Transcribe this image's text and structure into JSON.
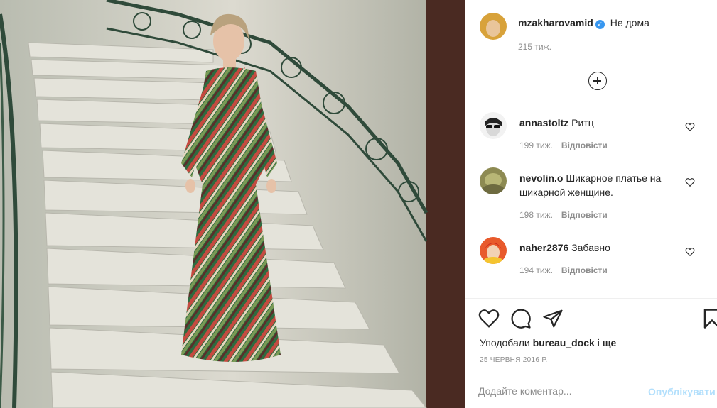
{
  "post": {
    "author": "mzakharovamid",
    "caption": "Не дома",
    "time": "215 тиж.",
    "verified_icon": "verified-badge-icon"
  },
  "comments": [
    {
      "user": "annastoltz",
      "text": "Ритц",
      "time": "199 тиж.",
      "reply": "Відповісти"
    },
    {
      "user": "nevolin.o",
      "text": "Шикарное платье на шикарной женщине.",
      "time": "198 тиж.",
      "reply": "Відповісти"
    },
    {
      "user": "naher2876",
      "text": "Забавно",
      "time": "194 тиж.",
      "reply": "Відповісти"
    }
  ],
  "likes": {
    "prefix": "Уподобали",
    "user": "bureau_dock",
    "and": "і",
    "more": "ще"
  },
  "date": "25 ЧЕРВНЯ 2016 Р.",
  "add_comment": {
    "placeholder": "Додайте коментар...",
    "post_label": "Опублікувати"
  },
  "icons": {
    "like": "heart-icon",
    "comment": "comment-bubble-icon",
    "share": "paper-plane-icon",
    "save": "bookmark-icon",
    "load_more": "plus-circle-icon"
  },
  "colors": {
    "text": "#262626",
    "muted": "#8e8e8e",
    "verified": "#3897f0",
    "post_disabled": "#b2dffc",
    "divider": "#efefef"
  }
}
